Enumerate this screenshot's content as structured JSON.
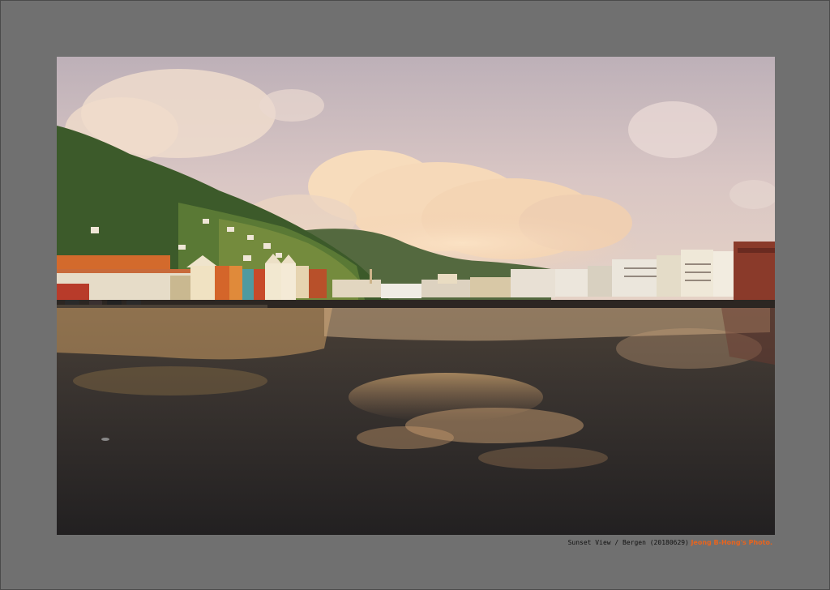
{
  "caption": {
    "description": "Sunset View / Bergen (20180629)",
    "credit": "Jeong B-Hong's Photo."
  },
  "photo": {
    "subject": "harbour-sunset-landscape",
    "colors": {
      "mat": "#707070",
      "sky_top": "#c9bcc2",
      "sky_bottom": "#e9d6c8",
      "cloud": "#f6dcc0",
      "hill": "#3e5a2b",
      "water_dark": "#2a2828",
      "reflection": "#c9a070",
      "credit_orange": "#e8641e"
    }
  }
}
